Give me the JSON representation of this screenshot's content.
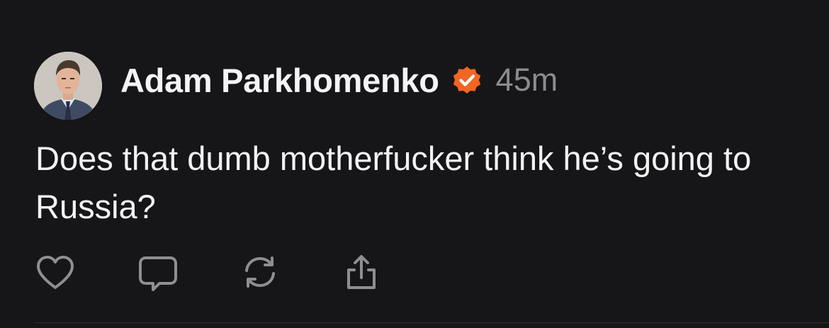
{
  "post": {
    "author": {
      "name": "Adam Parkhomenko",
      "verified_icon": "verified-badge-icon",
      "verified_color": "#f26522"
    },
    "timestamp": "45m",
    "text": "Does that dumb motherfucker think he’s going to Russia?"
  },
  "actions": [
    {
      "icon": "heart-icon"
    },
    {
      "icon": "comment-icon"
    },
    {
      "icon": "repost-icon"
    },
    {
      "icon": "share-icon"
    }
  ],
  "colors": {
    "background": "#161618",
    "text": "#f2f2f2",
    "muted": "#8c8c90",
    "icon": "#8e8e93",
    "accent": "#f26522"
  }
}
